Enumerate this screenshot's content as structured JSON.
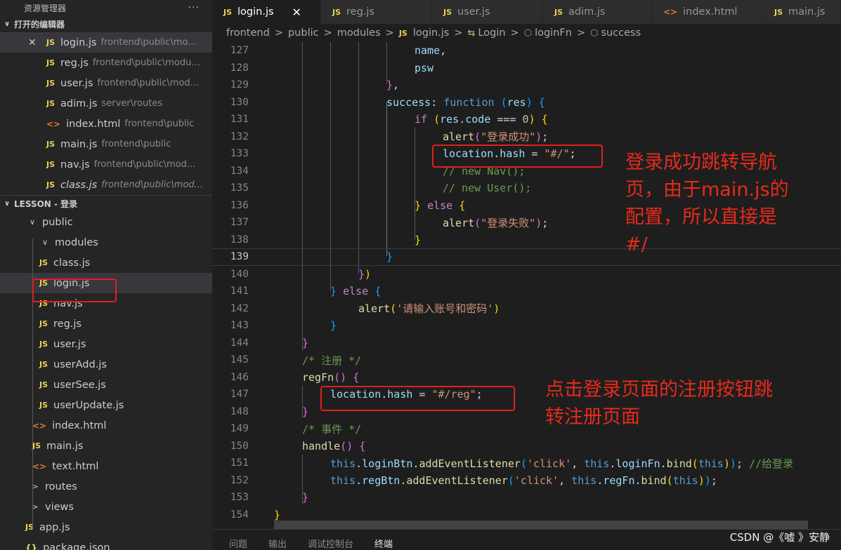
{
  "sidebar": {
    "title": "资源管理器",
    "more": "···",
    "open_editors": {
      "label": "打开的编辑器",
      "items": [
        {
          "icon": "JS",
          "name": "login.js",
          "path": "frontend\\public\\mo...",
          "active": true
        },
        {
          "icon": "JS",
          "name": "reg.js",
          "path": "frontend\\public\\modu..."
        },
        {
          "icon": "JS",
          "name": "user.js",
          "path": "frontend\\public\\mod..."
        },
        {
          "icon": "JS",
          "name": "adim.js",
          "path": "server\\routes"
        },
        {
          "icon": "<>",
          "name": "index.html",
          "path": "frontend\\public"
        },
        {
          "icon": "JS",
          "name": "main.js",
          "path": "frontend\\public"
        },
        {
          "icon": "JS",
          "name": "nav.js",
          "path": "frontend\\public\\mod..."
        },
        {
          "icon": "JS",
          "name": "class.js",
          "path": "frontend\\public\\mod..."
        }
      ]
    },
    "workspace": {
      "label": "LESSON - 登录",
      "tree": [
        {
          "type": "folder",
          "name": "public",
          "open": true
        },
        {
          "type": "folder",
          "name": "modules",
          "open": true
        },
        {
          "type": "js",
          "name": "class.js"
        },
        {
          "type": "js",
          "name": "login.js"
        },
        {
          "type": "js",
          "name": "nav.js"
        },
        {
          "type": "js",
          "name": "reg.js"
        },
        {
          "type": "js",
          "name": "user.js"
        },
        {
          "type": "js",
          "name": "userAdd.js"
        },
        {
          "type": "js",
          "name": "userSee.js"
        },
        {
          "type": "js",
          "name": "userUpdate.js"
        },
        {
          "type": "html",
          "name": "index.html"
        },
        {
          "type": "js",
          "name": "main.js"
        },
        {
          "type": "html",
          "name": "text.html"
        },
        {
          "type": "folder",
          "name": "routes",
          "open": false
        },
        {
          "type": "folder",
          "name": "views",
          "open": false
        },
        {
          "type": "js",
          "name": "app.js"
        },
        {
          "type": "json",
          "name": "package.json"
        }
      ]
    },
    "icons": {
      "js": "JS",
      "html": "<>",
      "json": "{}",
      "close": "✕",
      "chev_open": "∨",
      "chev_closed": ">"
    }
  },
  "tabs": [
    {
      "icon": "JS",
      "label": "login.js",
      "active": true,
      "close": "✕"
    },
    {
      "icon": "JS",
      "label": "reg.js"
    },
    {
      "icon": "JS",
      "label": "user.js"
    },
    {
      "icon": "JS",
      "label": "adim.js"
    },
    {
      "icon": "<>",
      "label": "index.html"
    },
    {
      "icon": "JS",
      "label": "main.js"
    }
  ],
  "breadcrumb": {
    "parts": [
      "frontend",
      "public",
      "modules"
    ],
    "file": "login.js",
    "file_icon": "JS",
    "symbols": [
      {
        "icon": "⇆",
        "label": "Login"
      },
      {
        "icon": "⬡",
        "label": "loginFn"
      },
      {
        "icon": "⬡",
        "label": "success"
      }
    ],
    "sep": ">"
  },
  "editor": {
    "current_line": 139,
    "lines": [
      {
        "n": "127",
        "tokens": [
          [
            "tk-var",
            "name"
          ],
          [
            "tk-plain",
            ","
          ]
        ]
      },
      {
        "n": "128",
        "tokens": [
          [
            "tk-var",
            "psw"
          ]
        ]
      },
      {
        "n": "129",
        "tokens": [
          [
            "tk-br2",
            "}"
          ],
          [
            "tk-plain",
            ","
          ]
        ]
      },
      {
        "n": "130",
        "tokens": [
          [
            "tk-var",
            "success"
          ],
          [
            "tk-plain",
            ": "
          ],
          [
            "tk-kw",
            "function"
          ],
          [
            "tk-plain",
            " "
          ],
          [
            "tk-br3",
            "("
          ],
          [
            "tk-var",
            "res"
          ],
          [
            "tk-br3",
            ")"
          ],
          [
            "tk-plain",
            " "
          ],
          [
            "tk-br3",
            "{"
          ]
        ]
      },
      {
        "n": "131",
        "tokens": [
          [
            "tk-kw2",
            "if"
          ],
          [
            "tk-plain",
            " "
          ],
          [
            "tk-br1",
            "("
          ],
          [
            "tk-var",
            "res"
          ],
          [
            "tk-plain",
            "."
          ],
          [
            "tk-var",
            "code"
          ],
          [
            "tk-plain",
            " === "
          ],
          [
            "tk-num",
            "0"
          ],
          [
            "tk-br1",
            ")"
          ],
          [
            "tk-plain",
            " "
          ],
          [
            "tk-br1",
            "{"
          ]
        ]
      },
      {
        "n": "132",
        "tokens": [
          [
            "tk-fn",
            "alert"
          ],
          [
            "tk-br2",
            "("
          ],
          [
            "tk-str",
            "\"登录成功\""
          ],
          [
            "tk-br2",
            ")"
          ],
          [
            "tk-plain",
            ";"
          ]
        ]
      },
      {
        "n": "133",
        "tokens": [
          [
            "tk-var",
            "location"
          ],
          [
            "tk-plain",
            "."
          ],
          [
            "tk-var",
            "hash"
          ],
          [
            "tk-plain",
            " = "
          ],
          [
            "tk-str",
            "\"#/\""
          ],
          [
            "tk-plain",
            ";"
          ]
        ]
      },
      {
        "n": "134",
        "tokens": [
          [
            "tk-com",
            "// new Nav();"
          ]
        ]
      },
      {
        "n": "135",
        "tokens": [
          [
            "tk-com",
            "// new User();"
          ]
        ]
      },
      {
        "n": "136",
        "tokens": [
          [
            "tk-br1",
            "}"
          ],
          [
            "tk-plain",
            " "
          ],
          [
            "tk-kw2",
            "else"
          ],
          [
            "tk-plain",
            " "
          ],
          [
            "tk-br1",
            "{"
          ]
        ]
      },
      {
        "n": "137",
        "tokens": [
          [
            "tk-fn",
            "alert"
          ],
          [
            "tk-br2",
            "("
          ],
          [
            "tk-str",
            "\"登录失败\""
          ],
          [
            "tk-br2",
            ")"
          ],
          [
            "tk-plain",
            ";"
          ]
        ]
      },
      {
        "n": "138",
        "tokens": [
          [
            "tk-br1",
            "}"
          ]
        ]
      },
      {
        "n": "139",
        "tokens": [
          [
            "tk-br3",
            "}"
          ]
        ]
      },
      {
        "n": "140",
        "tokens": [
          [
            "tk-br2",
            "}"
          ],
          [
            "tk-br1",
            ")"
          ]
        ]
      },
      {
        "n": "141",
        "tokens": [
          [
            "tk-br3",
            "}"
          ],
          [
            "tk-plain",
            " "
          ],
          [
            "tk-kw2",
            "else"
          ],
          [
            "tk-plain",
            " "
          ],
          [
            "tk-br3",
            "{"
          ]
        ]
      },
      {
        "n": "142",
        "tokens": [
          [
            "tk-fn",
            "alert"
          ],
          [
            "tk-br1",
            "("
          ],
          [
            "tk-str",
            "'请输入账号和密码'"
          ],
          [
            "tk-br1",
            ")"
          ]
        ]
      },
      {
        "n": "143",
        "tokens": [
          [
            "tk-br3",
            "}"
          ]
        ]
      },
      {
        "n": "144",
        "tokens": [
          [
            "tk-br2",
            "}"
          ]
        ]
      },
      {
        "n": "145",
        "tokens": [
          [
            "tk-com",
            "/* 注册 */"
          ]
        ]
      },
      {
        "n": "146",
        "tokens": [
          [
            "tk-fn",
            "regFn"
          ],
          [
            "tk-br2",
            "()"
          ],
          [
            "tk-plain",
            " "
          ],
          [
            "tk-br2",
            "{"
          ]
        ]
      },
      {
        "n": "147",
        "tokens": [
          [
            "tk-var",
            "location"
          ],
          [
            "tk-plain",
            "."
          ],
          [
            "tk-var",
            "hash"
          ],
          [
            "tk-plain",
            " = "
          ],
          [
            "tk-str",
            "\"#/reg\""
          ],
          [
            "tk-plain",
            ";"
          ]
        ]
      },
      {
        "n": "148",
        "tokens": [
          [
            "tk-br2",
            "}"
          ]
        ]
      },
      {
        "n": "149",
        "tokens": [
          [
            "tk-com",
            "/* 事件 */"
          ]
        ]
      },
      {
        "n": "150",
        "tokens": [
          [
            "tk-fn",
            "handle"
          ],
          [
            "tk-br2",
            "()"
          ],
          [
            "tk-plain",
            " "
          ],
          [
            "tk-br2",
            "{"
          ]
        ]
      },
      {
        "n": "151",
        "tokens": [
          [
            "tk-kw",
            "this"
          ],
          [
            "tk-plain",
            "."
          ],
          [
            "tk-var",
            "loginBtn"
          ],
          [
            "tk-plain",
            "."
          ],
          [
            "tk-fn",
            "addEventListener"
          ],
          [
            "tk-br3",
            "("
          ],
          [
            "tk-str",
            "'click'"
          ],
          [
            "tk-plain",
            ", "
          ],
          [
            "tk-kw",
            "this"
          ],
          [
            "tk-plain",
            "."
          ],
          [
            "tk-var",
            "loginFn"
          ],
          [
            "tk-plain",
            "."
          ],
          [
            "tk-fn",
            "bind"
          ],
          [
            "tk-br1",
            "("
          ],
          [
            "tk-kw",
            "this"
          ],
          [
            "tk-br1",
            ")"
          ],
          [
            "tk-br3",
            ")"
          ],
          [
            "tk-plain",
            "; "
          ],
          [
            "tk-com",
            "//给登录"
          ]
        ]
      },
      {
        "n": "152",
        "tokens": [
          [
            "tk-kw",
            "this"
          ],
          [
            "tk-plain",
            "."
          ],
          [
            "tk-var",
            "regBtn"
          ],
          [
            "tk-plain",
            "."
          ],
          [
            "tk-fn",
            "addEventListener"
          ],
          [
            "tk-br3",
            "("
          ],
          [
            "tk-str",
            "'click'"
          ],
          [
            "tk-plain",
            ", "
          ],
          [
            "tk-kw",
            "this"
          ],
          [
            "tk-plain",
            "."
          ],
          [
            "tk-var",
            "regFn"
          ],
          [
            "tk-plain",
            "."
          ],
          [
            "tk-fn",
            "bind"
          ],
          [
            "tk-br1",
            "("
          ],
          [
            "tk-kw",
            "this"
          ],
          [
            "tk-br1",
            ")"
          ],
          [
            "tk-br3",
            ")"
          ],
          [
            "tk-plain",
            ";"
          ]
        ]
      },
      {
        "n": "153",
        "tokens": [
          [
            "tk-br2",
            "}"
          ]
        ]
      },
      {
        "n": "154",
        "tokens": [
          [
            "tk-br1",
            "}"
          ]
        ]
      }
    ]
  },
  "annotations": {
    "first": [
      "登录成功跳转导航",
      "页，由于main.js的",
      "配置，所以直接是",
      "#/"
    ],
    "second": [
      "点击登录页面的注册按钮跳",
      "转注册页面"
    ]
  },
  "panel": {
    "tabs": [
      "问题",
      "输出",
      "调试控制台",
      "终端"
    ],
    "active": "终端"
  },
  "watermark": "CSDN @《嘘 》安静"
}
